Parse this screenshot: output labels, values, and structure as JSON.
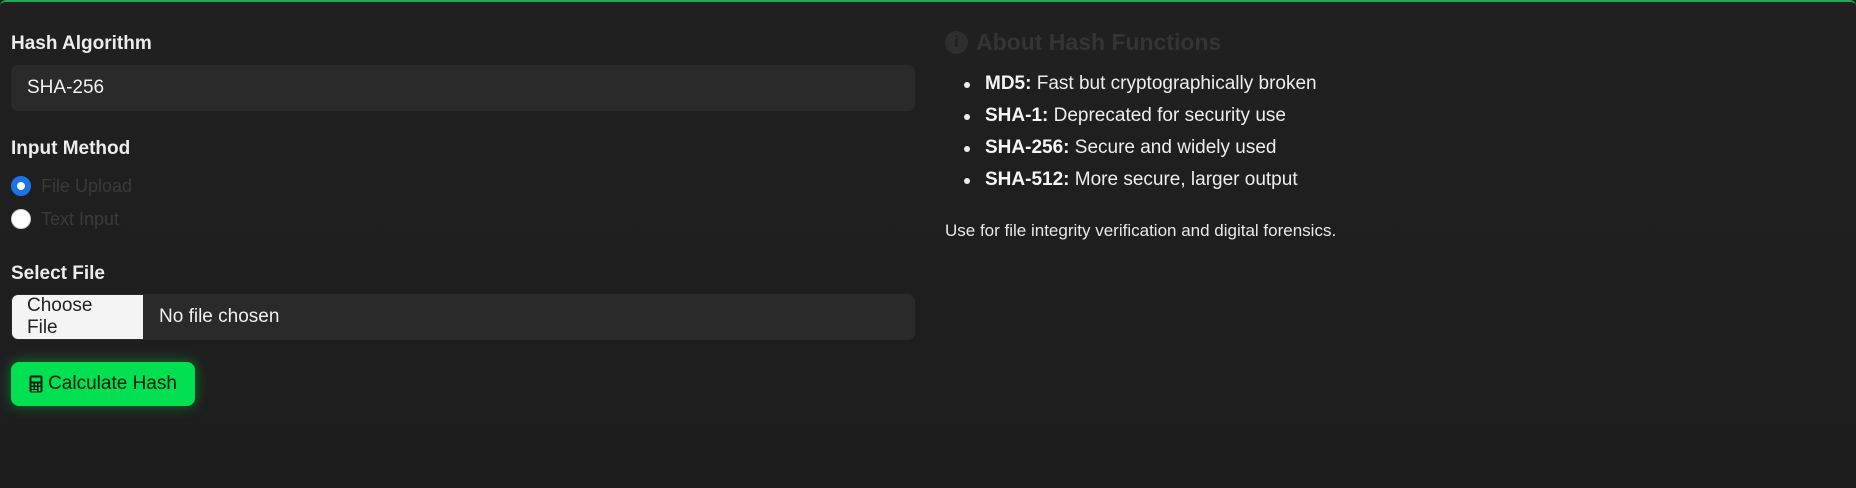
{
  "form": {
    "algorithm_label": "Hash Algorithm",
    "algorithm_value": "SHA-256",
    "input_method_label": "Input Method",
    "input_methods": [
      {
        "label": "File Upload",
        "checked": true
      },
      {
        "label": "Text Input",
        "checked": false
      }
    ],
    "select_file_label": "Select File",
    "choose_file_button": "Choose File",
    "file_status": "No file chosen",
    "calculate_button": "Calculate Hash",
    "calculate_icon": "calculator-icon"
  },
  "about": {
    "title": "About Hash Functions",
    "title_icon": "info-icon",
    "items": [
      {
        "name": "MD5:",
        "desc": "Fast but cryptographically broken"
      },
      {
        "name": "SHA-1:",
        "desc": "Deprecated for security use"
      },
      {
        "name": "SHA-256:",
        "desc": "Secure and widely used"
      },
      {
        "name": "SHA-512:",
        "desc": "More secure, larger output"
      }
    ],
    "note": "Use for file integrity verification and digital forensics."
  },
  "colors": {
    "accent_green": "#00e050",
    "radio_blue": "#1a73e8",
    "background": "#1c1c1c"
  }
}
